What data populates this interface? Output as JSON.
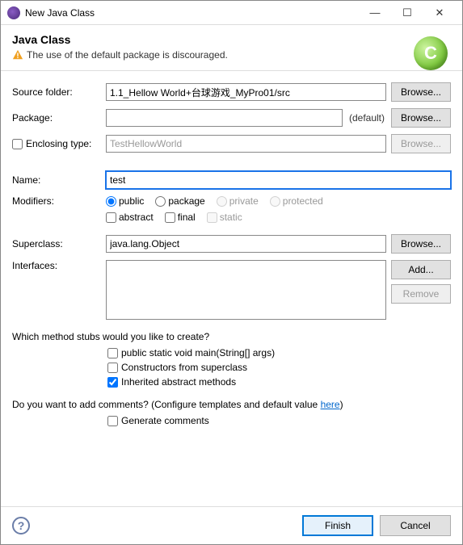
{
  "titlebar": {
    "title": "New Java Class"
  },
  "header": {
    "title": "Java Class",
    "message": "The use of the default package is discouraged.",
    "logoLetter": "C"
  },
  "sourceFolder": {
    "label": "Source folder:",
    "value": "1.1_Hellow World+台球游戏_MyPro01/src",
    "browse": "Browse..."
  },
  "package": {
    "label": "Package:",
    "value": "",
    "default": "(default)",
    "browse": "Browse..."
  },
  "enclosing": {
    "label": "Enclosing type:",
    "value": "TestHellowWorld",
    "browse": "Browse..."
  },
  "name": {
    "label": "Name:",
    "value": "test"
  },
  "modifiers": {
    "label": "Modifiers:",
    "public": "public",
    "package": "package",
    "private": "private",
    "protected": "protected",
    "abstract": "abstract",
    "final": "final",
    "static": "static"
  },
  "superclass": {
    "label": "Superclass:",
    "value": "java.lang.Object",
    "browse": "Browse..."
  },
  "interfaces": {
    "label": "Interfaces:",
    "add": "Add...",
    "remove": "Remove"
  },
  "stubs": {
    "question": "Which method stubs would you like to create?",
    "main": "public static void main(String[] args)",
    "constructors": "Constructors from superclass",
    "inherited": "Inherited abstract methods"
  },
  "comments": {
    "question_pre": "Do you want to add comments? (Configure templates and default value ",
    "link": "here",
    "question_post": ")",
    "generate": "Generate comments"
  },
  "footer": {
    "finish": "Finish",
    "cancel": "Cancel"
  }
}
